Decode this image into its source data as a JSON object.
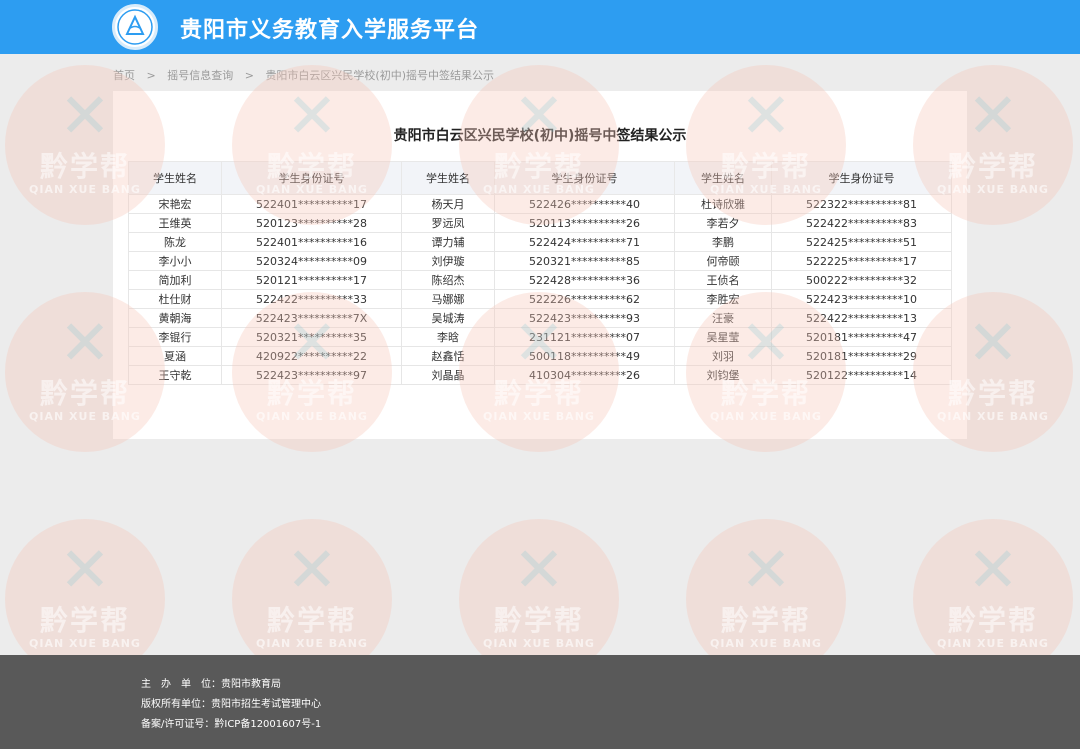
{
  "header": {
    "site_title": "贵阳市义务教育入学服务平台",
    "logo_icon": "school-emblem-icon"
  },
  "breadcrumb": {
    "items": [
      "首页",
      "摇号信息查询",
      "贵阳市白云区兴民学校(初中)摇号中签结果公示"
    ],
    "separator": ">"
  },
  "page_title": "贵阳市白云区兴民学校(初中)摇号中签结果公示",
  "table": {
    "headers": [
      "学生姓名",
      "学生身份证号",
      "学生姓名",
      "学生身份证号",
      "学生姓名",
      "学生身份证号"
    ],
    "rows": [
      [
        "宋艳宏",
        "522401**********17",
        "杨天月",
        "522426**********40",
        "杜诗欣雅",
        "522322**********81"
      ],
      [
        "王维英",
        "520123**********28",
        "罗远凤",
        "520113**********26",
        "李若夕",
        "522422**********83"
      ],
      [
        "陈龙",
        "522401**********16",
        "谭力辅",
        "522424**********71",
        "李鹏",
        "522425**********51"
      ],
      [
        "李小小",
        "520324**********09",
        "刘伊璇",
        "520321**********85",
        "何帝颐",
        "522225**********17"
      ],
      [
        "简加利",
        "520121**********17",
        "陈绍杰",
        "522428**********36",
        "王侦名",
        "500222**********32"
      ],
      [
        "杜仕财",
        "522422**********33",
        "马娜娜",
        "522226**********62",
        "李胜宏",
        "522423**********10"
      ],
      [
        "黄朝海",
        "522423**********7X",
        "吴城涛",
        "522423**********93",
        "汪豪",
        "522422**********13"
      ],
      [
        "李锟行",
        "520321**********35",
        "李晗",
        "231121**********07",
        "吴星莹",
        "520181**********47"
      ],
      [
        "夏涵",
        "420922**********22",
        "赵鑫恬",
        "500118**********49",
        "刘羽",
        "520181**********29"
      ],
      [
        "王守乾",
        "522423**********97",
        "刘晶晶",
        "410304**********26",
        "刘钧堡",
        "520122**********14"
      ]
    ]
  },
  "footer": {
    "lines": [
      "主　办　单　位：贵阳市教育局",
      "版权所有单位：贵阳市招生考试管理中心",
      "备案/许可证号：黔ICP备12001607号-1"
    ]
  },
  "watermark": {
    "text": "黔学帮",
    "subtext": "QIAN XUE BANG",
    "icon": "qianxuebang-logo-icon"
  },
  "colors": {
    "header_bg": "#2d9df1",
    "footer_bg": "#595959",
    "page_bg": "#ececec"
  }
}
